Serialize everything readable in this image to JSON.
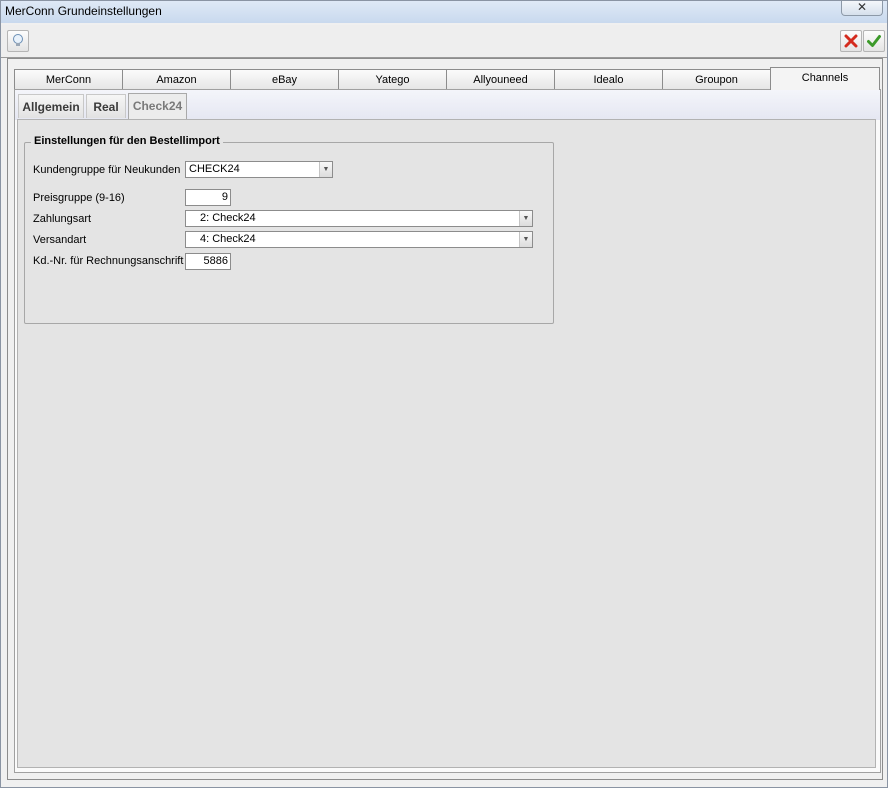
{
  "window": {
    "title": "MerConn Grundeinstellungen",
    "close_label": "✕"
  },
  "toolbar": {
    "hint_icon": "lightbulb-icon",
    "cancel_icon": "red-x-icon",
    "ok_icon": "green-check-icon"
  },
  "main_tabs": [
    {
      "label": "MerConn"
    },
    {
      "label": "Amazon"
    },
    {
      "label": "eBay"
    },
    {
      "label": "Yatego"
    },
    {
      "label": "Allyouneed"
    },
    {
      "label": "Idealo"
    },
    {
      "label": "Groupon"
    },
    {
      "label": "Channels",
      "active": true
    }
  ],
  "sub_tabs": [
    {
      "label": "Allgemein"
    },
    {
      "label": "Real"
    },
    {
      "label": "Check24",
      "active": true
    }
  ],
  "group": {
    "title": "Einstellungen für den Bestellimport",
    "fields": {
      "kundengruppe": {
        "label": "Kundengruppe für Neukunden",
        "value": "CHECK24"
      },
      "preisgruppe": {
        "label": "Preisgruppe (9-16)",
        "value": "9"
      },
      "zahlungsart": {
        "label": "Zahlungsart",
        "value": "2: Check24"
      },
      "versandart": {
        "label": "Versandart",
        "value": "4: Check24"
      },
      "kdnr": {
        "label": "Kd.-Nr. für Rechnungsanschrift",
        "value": "5886"
      }
    }
  }
}
